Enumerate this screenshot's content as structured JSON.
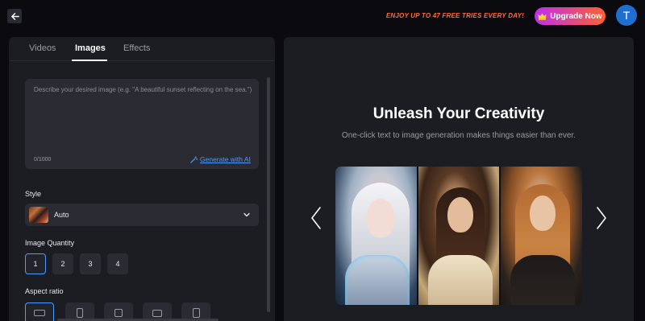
{
  "header": {
    "promo_text": "ENJOY UP TO 47 FREE TRIES EVERY DAY!",
    "upgrade_label": "Upgrade Now",
    "avatar_initial": "T"
  },
  "tabs": [
    {
      "label": "Videos"
    },
    {
      "label": "Images"
    },
    {
      "label": "Effects"
    }
  ],
  "prompt": {
    "placeholder": "Describe your desired image (e.g. \"A beautiful sunset reflecting on the sea.\")",
    "char_count": "0/1000",
    "generate_ai_label": "Generate with AI"
  },
  "style": {
    "label": "Style",
    "selected": "Auto"
  },
  "quantity": {
    "label": "Image Quantity",
    "options": [
      "1",
      "2",
      "3",
      "4"
    ],
    "selected": "1"
  },
  "aspect_ratio": {
    "label": "Aspect ratio"
  },
  "hero": {
    "title": "Unleash Your Creativity",
    "subtitle": "One-click text to image generation makes things easier than ever."
  },
  "colors": {
    "accent": "#4c9bff",
    "promo": "#ff6a3d",
    "background": "#0b0b0f",
    "panel": "#1c1d22"
  }
}
